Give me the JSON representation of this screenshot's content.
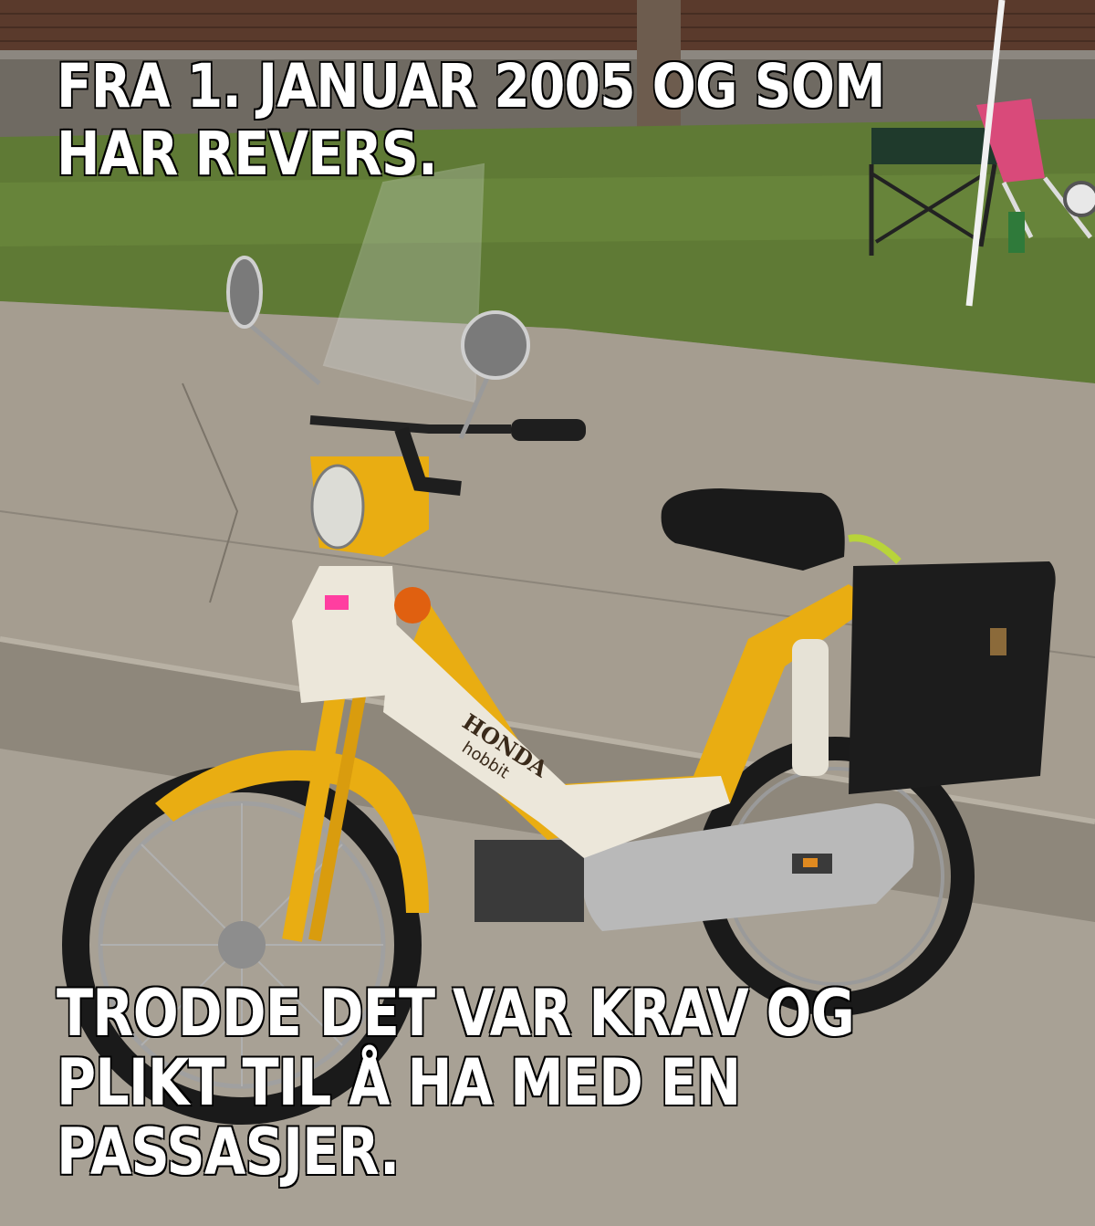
{
  "meme": {
    "top_text": [
      "FRA 1. JANUAR 2005 OG SOM",
      "HAR REVERS."
    ],
    "bottom_text": [
      "TRODDE DET VAR KRAV OG",
      "PLIKT TIL Å HA MED EN",
      "PASSASJER."
    ]
  },
  "photo": {
    "subject": "moped-photo",
    "brand_logo": "HONDA",
    "model_logo": "hobbit",
    "colors": {
      "frame_yellow": "#e9ad12",
      "body_white": "#ece7da",
      "pavement": "#a59d90",
      "grass": "#5f7a35",
      "wall_brick": "#5a3a2c",
      "saddlebag": "#1c1c1c"
    }
  }
}
